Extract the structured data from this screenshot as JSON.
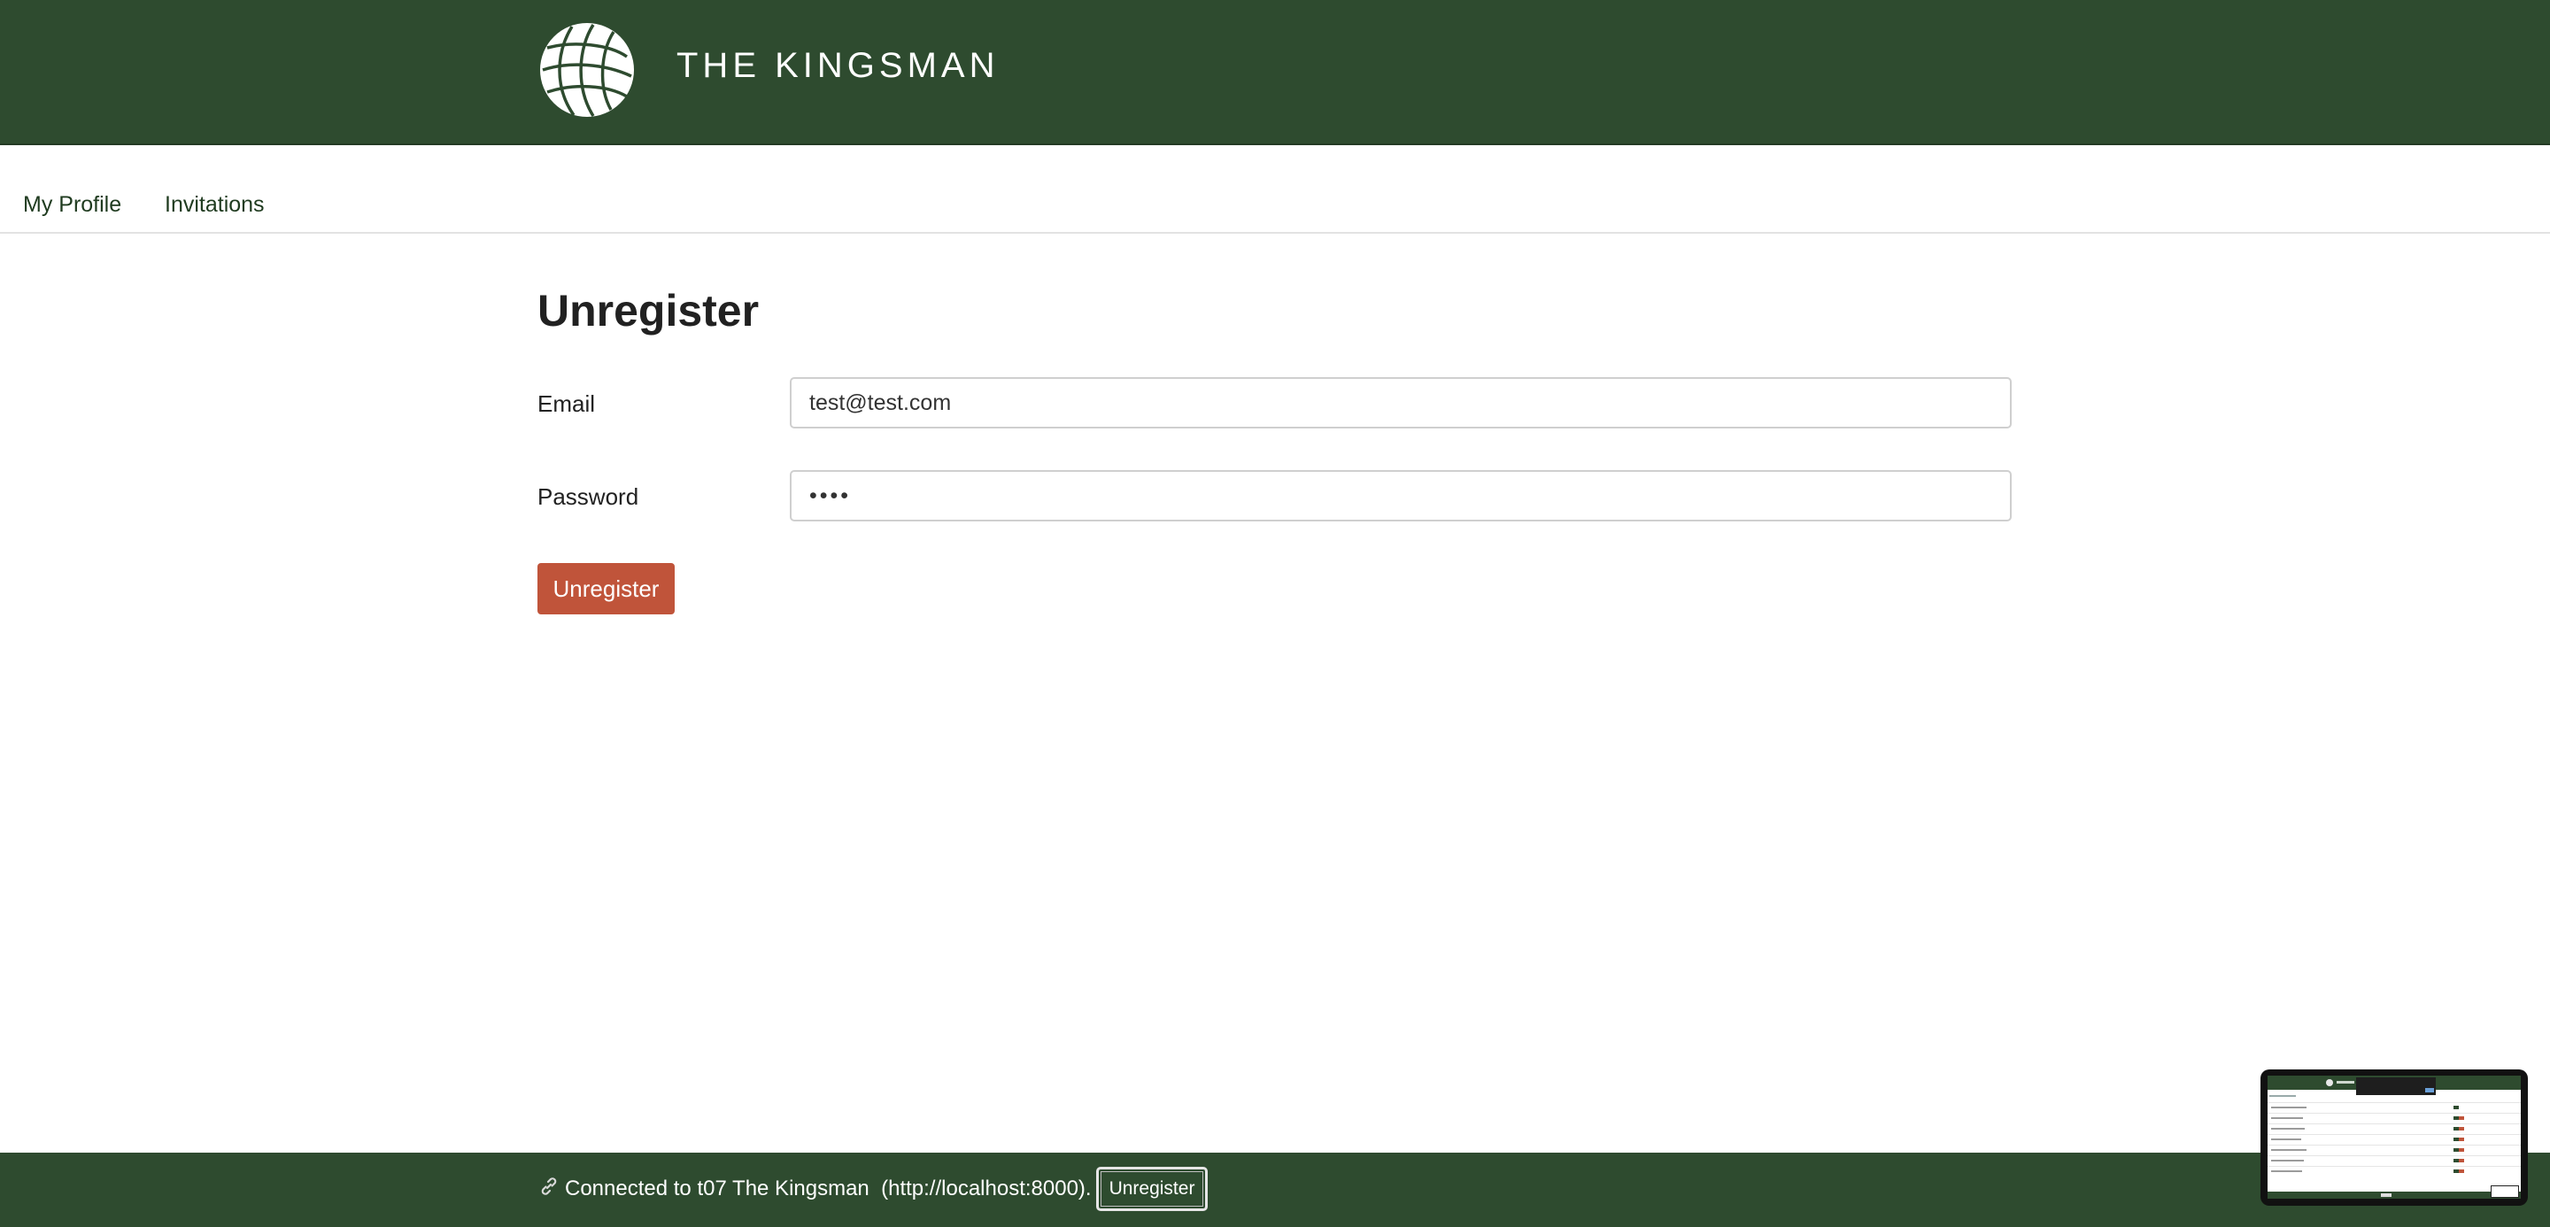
{
  "header": {
    "brand": "THE KINGSMAN",
    "logo_icon": "globe-icon",
    "background": "#2e4b2f"
  },
  "nav": {
    "items": [
      {
        "label": "My Profile"
      },
      {
        "label": "Invitations"
      }
    ]
  },
  "form": {
    "title": "Unregister",
    "email": {
      "label": "Email",
      "value": "test@test.com"
    },
    "password": {
      "label": "Password",
      "value": "••••"
    },
    "submit_label": "Unregister",
    "submit_color": "#c0543a"
  },
  "footer": {
    "icon": "link-icon",
    "status_text": "Connected to t07 The Kingsman  (http://localhost:8000).",
    "button_label": "Unregister"
  }
}
